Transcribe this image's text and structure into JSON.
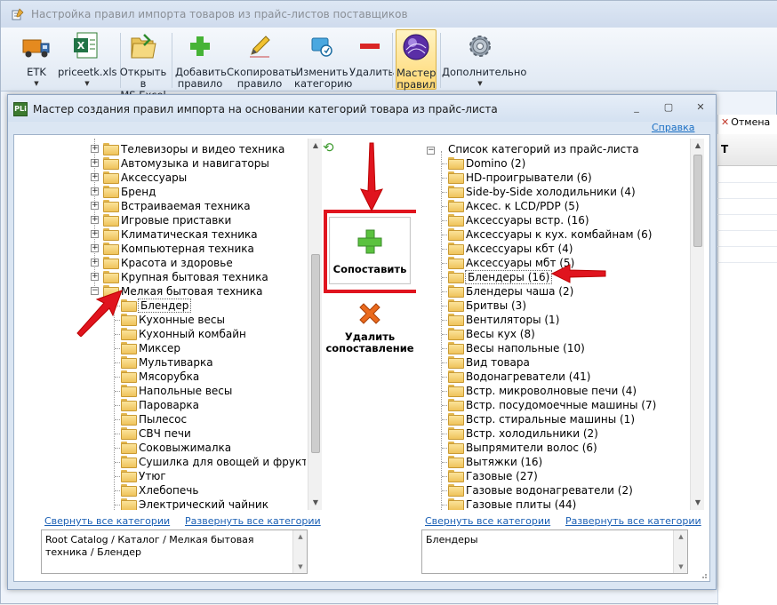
{
  "main_window": {
    "title": "Настройка правил импорта товаров из прайс-листов поставщиков"
  },
  "ribbon": {
    "buttons": [
      {
        "label": "ETK",
        "icon": "truck-icon",
        "has_dropdown": true
      },
      {
        "label": "priceetk.xls",
        "icon": "excel-file-icon",
        "has_dropdown": true
      },
      {
        "label": "Открыть в\nMS Excel",
        "icon": "open-folder-icon"
      },
      {
        "label": "Добавить\nправило",
        "icon": "plus-icon"
      },
      {
        "label": "Скопировать\nправило",
        "icon": "pencil-icon"
      },
      {
        "label": "Изменить\nкатегорию",
        "icon": "edit-category-icon"
      },
      {
        "label": "Удалить",
        "icon": "minus-icon"
      },
      {
        "label": "Мастер\nправил",
        "icon": "wizard-orb-icon",
        "active": true
      },
      {
        "label": "Дополнительно",
        "icon": "gear-icon",
        "has_dropdown": true
      }
    ]
  },
  "background": {
    "cancel_label": "Отмена",
    "grid_header": "Т"
  },
  "dialog": {
    "title": "Мастер создания правил импорта на основании категорий товара из прайс-листа",
    "help_link": "Справка",
    "left_tree": {
      "items": [
        {
          "label": "Телевизоры и видео техника",
          "expander": "+"
        },
        {
          "label": "Автомузыка и навигаторы",
          "expander": "+"
        },
        {
          "label": "Аксессуары",
          "expander": "+"
        },
        {
          "label": "Бренд",
          "expander": "+"
        },
        {
          "label": "Встраиваемая техника",
          "expander": "+"
        },
        {
          "label": "Игровые приставки",
          "expander": "+"
        },
        {
          "label": "Климатическая техника",
          "expander": "+"
        },
        {
          "label": "Компьютерная техника",
          "expander": "+"
        },
        {
          "label": "Красота и здоровье",
          "expander": "+"
        },
        {
          "label": "Крупная бытовая техника",
          "expander": "+"
        },
        {
          "label": "Мелкая бытовая техника",
          "expander": "−"
        }
      ],
      "children": [
        {
          "label": "Блендер",
          "selected": true
        },
        {
          "label": "Кухонные весы"
        },
        {
          "label": "Кухонный комбайн"
        },
        {
          "label": "Миксер"
        },
        {
          "label": "Мультиварка"
        },
        {
          "label": "Мясорубка"
        },
        {
          "label": "Напольные весы"
        },
        {
          "label": "Пароварка"
        },
        {
          "label": "Пылесос"
        },
        {
          "label": "СВЧ печи"
        },
        {
          "label": "Соковыжималка"
        },
        {
          "label": "Сушилка для овощей и фруктов"
        },
        {
          "label": "Утюг"
        },
        {
          "label": "Хлебопечь"
        },
        {
          "label": "Электрический чайник"
        }
      ],
      "collapse_all": "Свернуть все категории",
      "expand_all": "Развернуть все категории",
      "path": "Root Catalog / Каталог / Мелкая бытовая техника / Блендер"
    },
    "actions": {
      "map_label": "Сопоставить",
      "unmap_label": "Удалить\nсопоставление"
    },
    "right_tree": {
      "root_label": "Список категорий из прайс-листа",
      "root_expander": "−",
      "items": [
        {
          "label": "Domino (2)"
        },
        {
          "label": "HD-проигрыватели (6)"
        },
        {
          "label": "Side-by-Side холодильники (4)"
        },
        {
          "label": "Аксес. к LCD/PDP (5)"
        },
        {
          "label": "Аксессуары встр. (16)"
        },
        {
          "label": "Аксессуары к кух. комбайнам (6)"
        },
        {
          "label": "Аксессуары кбт (4)"
        },
        {
          "label": "Аксессуары мбт (5)"
        },
        {
          "label": "Блендеры (16)",
          "selected": true
        },
        {
          "label": "Блендеры чаша (2)"
        },
        {
          "label": "Бритвы (3)"
        },
        {
          "label": "Вентиляторы (1)"
        },
        {
          "label": "Весы кух (8)"
        },
        {
          "label": "Весы напольные (10)"
        },
        {
          "label": "Вид товара"
        },
        {
          "label": "Водонагреватели (41)"
        },
        {
          "label": "Встр. микроволновые печи (4)"
        },
        {
          "label": "Встр. посудомоечные машины (7)"
        },
        {
          "label": "Встр. стиральные машины (1)"
        },
        {
          "label": "Встр. холодильники (2)"
        },
        {
          "label": "Выпрямители волос (6)"
        },
        {
          "label": "Вытяжки (16)"
        },
        {
          "label": "Газовые (27)"
        },
        {
          "label": "Газовые водонагреватели (2)"
        },
        {
          "label": "Газовые плиты (44)"
        }
      ],
      "collapse_all": "Свернуть все категории",
      "expand_all": "Развернуть все категории",
      "path": "Блендеры"
    }
  },
  "colors": {
    "highlight_red": "#e0141e",
    "link_blue": "#1a5fb4",
    "folder_yellow": "#efc35b"
  }
}
